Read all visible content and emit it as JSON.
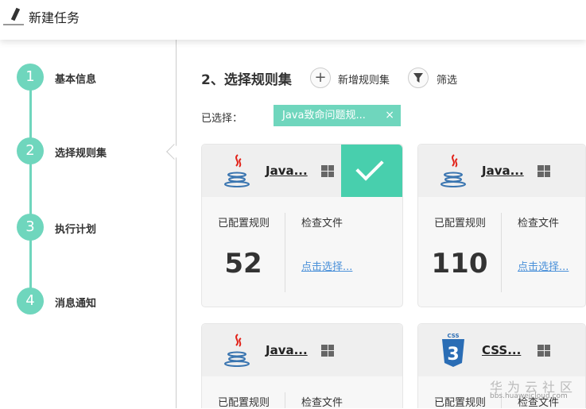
{
  "header": {
    "title": "新建任务"
  },
  "steps": [
    {
      "num": "1",
      "label": "基本信息"
    },
    {
      "num": "2",
      "label": "选择规则集"
    },
    {
      "num": "3",
      "label": "执行计划"
    },
    {
      "num": "4",
      "label": "消息通知"
    }
  ],
  "main": {
    "title": "2、选择规则集",
    "add_icon": "+",
    "add_label": "新增规则集",
    "filter_label": "筛选",
    "selected_label": "已选择：",
    "selected_tag": "Java致命问题规...",
    "tag_close": "×"
  },
  "cards": [
    {
      "name": "Java...",
      "icon": "java",
      "selected": true,
      "rules_label": "已配置规则",
      "rules": "52",
      "files_label": "检查文件",
      "files_link": "点击选择..."
    },
    {
      "name": "Java...",
      "icon": "java",
      "selected": false,
      "rules_label": "已配置规则",
      "rules": "110",
      "files_label": "检查文件",
      "files_link": "点击选择..."
    },
    {
      "name": "Java...",
      "icon": "java",
      "selected": false,
      "rules_label": "已配置规则",
      "files_label": "检查文件"
    },
    {
      "name": "CSS...",
      "icon": "css3",
      "selected": false,
      "rules_label": "已配置规则",
      "files_label": "检查文件"
    }
  ],
  "watermark": {
    "title": "华为云社区",
    "url": "bbs.huaweicloud.com"
  },
  "colors": {
    "accent": "#48cfad",
    "step": "#6fd6bd",
    "link": "#4a90d9"
  }
}
